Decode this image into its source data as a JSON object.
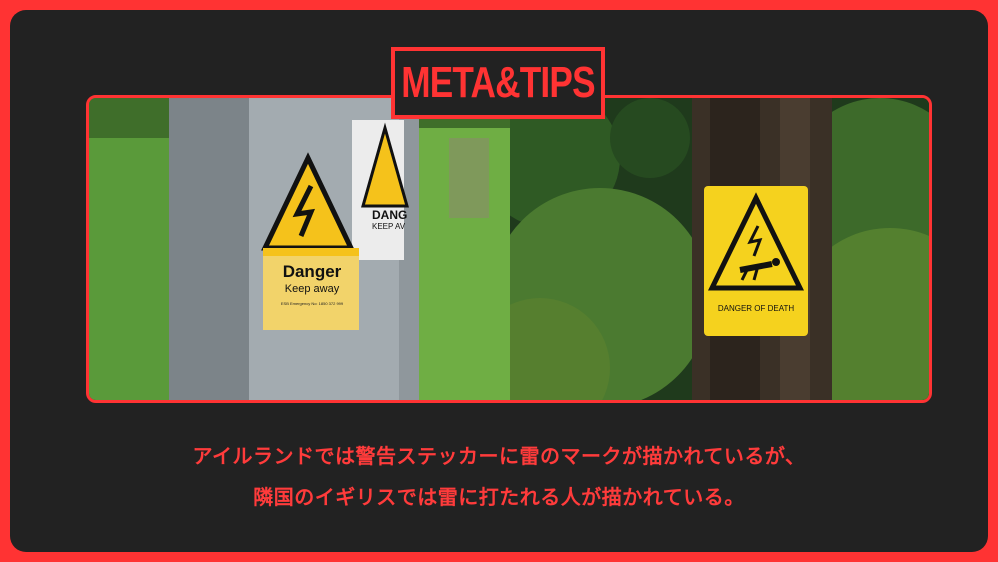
{
  "brand": {
    "label": "META&TIPS"
  },
  "photos": {
    "left": {
      "sign_heading": "Danger",
      "sign_subtext": "Keep away",
      "sign_fineprint": "ESB Emergency No: 1850 372 999",
      "partial_sign_heading": "DANG",
      "partial_sign_subtext": "KEEP AV"
    },
    "right": {
      "sign_text": "DANGER OF DEATH"
    }
  },
  "caption": {
    "line1": "アイルランドでは警告ステッカーに雷のマークが描かれているが、",
    "line2": "隣国のイギリスでは雷に打たれる人が描かれている。"
  },
  "colors": {
    "accent": "#ff3333",
    "card": "#222222",
    "sign_yellow": "#f5c21b"
  }
}
